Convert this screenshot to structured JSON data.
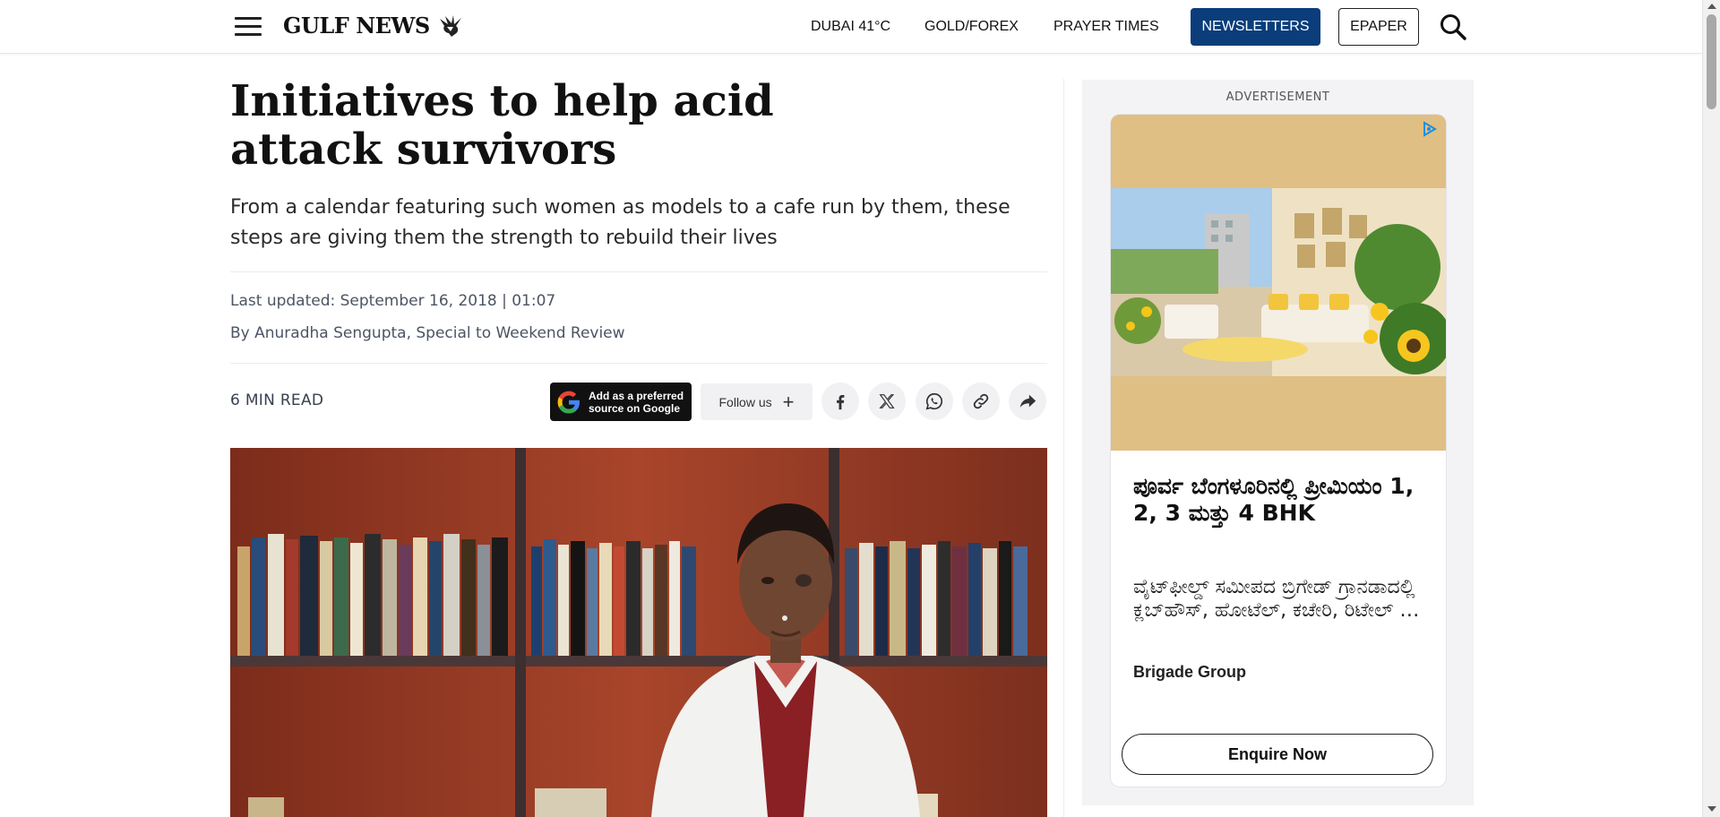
{
  "header": {
    "logo_text": "GULF NEWS",
    "nav": {
      "weather": "DUBAI 41°C",
      "gold_forex": "GOLD/FOREX",
      "prayer_times": "PRAYER TIMES",
      "newsletters": "NEWSLETTERS",
      "epaper": "EPAPER"
    },
    "colors": {
      "newsletters_bg": "#0a3d7a"
    }
  },
  "article": {
    "headline": "Initiatives to help acid attack survivors",
    "subheadline": "From a calendar featuring such women as models to a cafe run by them, these steps are giving them the strength to rebuild their lives",
    "last_updated": "Last updated: September 16, 2018 | 01:07",
    "byline": "By Anuradha Sengupta, Special to Weekend Review",
    "read_time": "6 MIN READ",
    "google_source": {
      "line1": "Add as a preferred",
      "line2": "source on Google"
    },
    "follow_label": "Follow us",
    "share_icons": [
      "facebook-icon",
      "x-icon",
      "whatsapp-icon",
      "link-icon",
      "share-icon"
    ]
  },
  "advertisement": {
    "label": "ADVERTISEMENT",
    "title": "ಪೂರ್ವ ಬೆಂಗಳೂರಿನಲ್ಲಿ ಪ್ರೀಮಿಯಂ 1, 2, 3 ಮತ್ತು 4 BHK",
    "description": "ವೈಟ್‌ಫೀಲ್ಡ್ ಸಮೀಪದ ಬ್ರಿಗೇಡ್ ಗ್ರಾನಡಾದಲ್ಲಿ ಕ್ಲಬ್‌ಹೌಸ್, ಹೋಟೆಲ್, ಕಚೇರಿ, ರಿಟೇಲ್ …",
    "brand": "Brigade Group",
    "cta": "Enquire Now"
  }
}
